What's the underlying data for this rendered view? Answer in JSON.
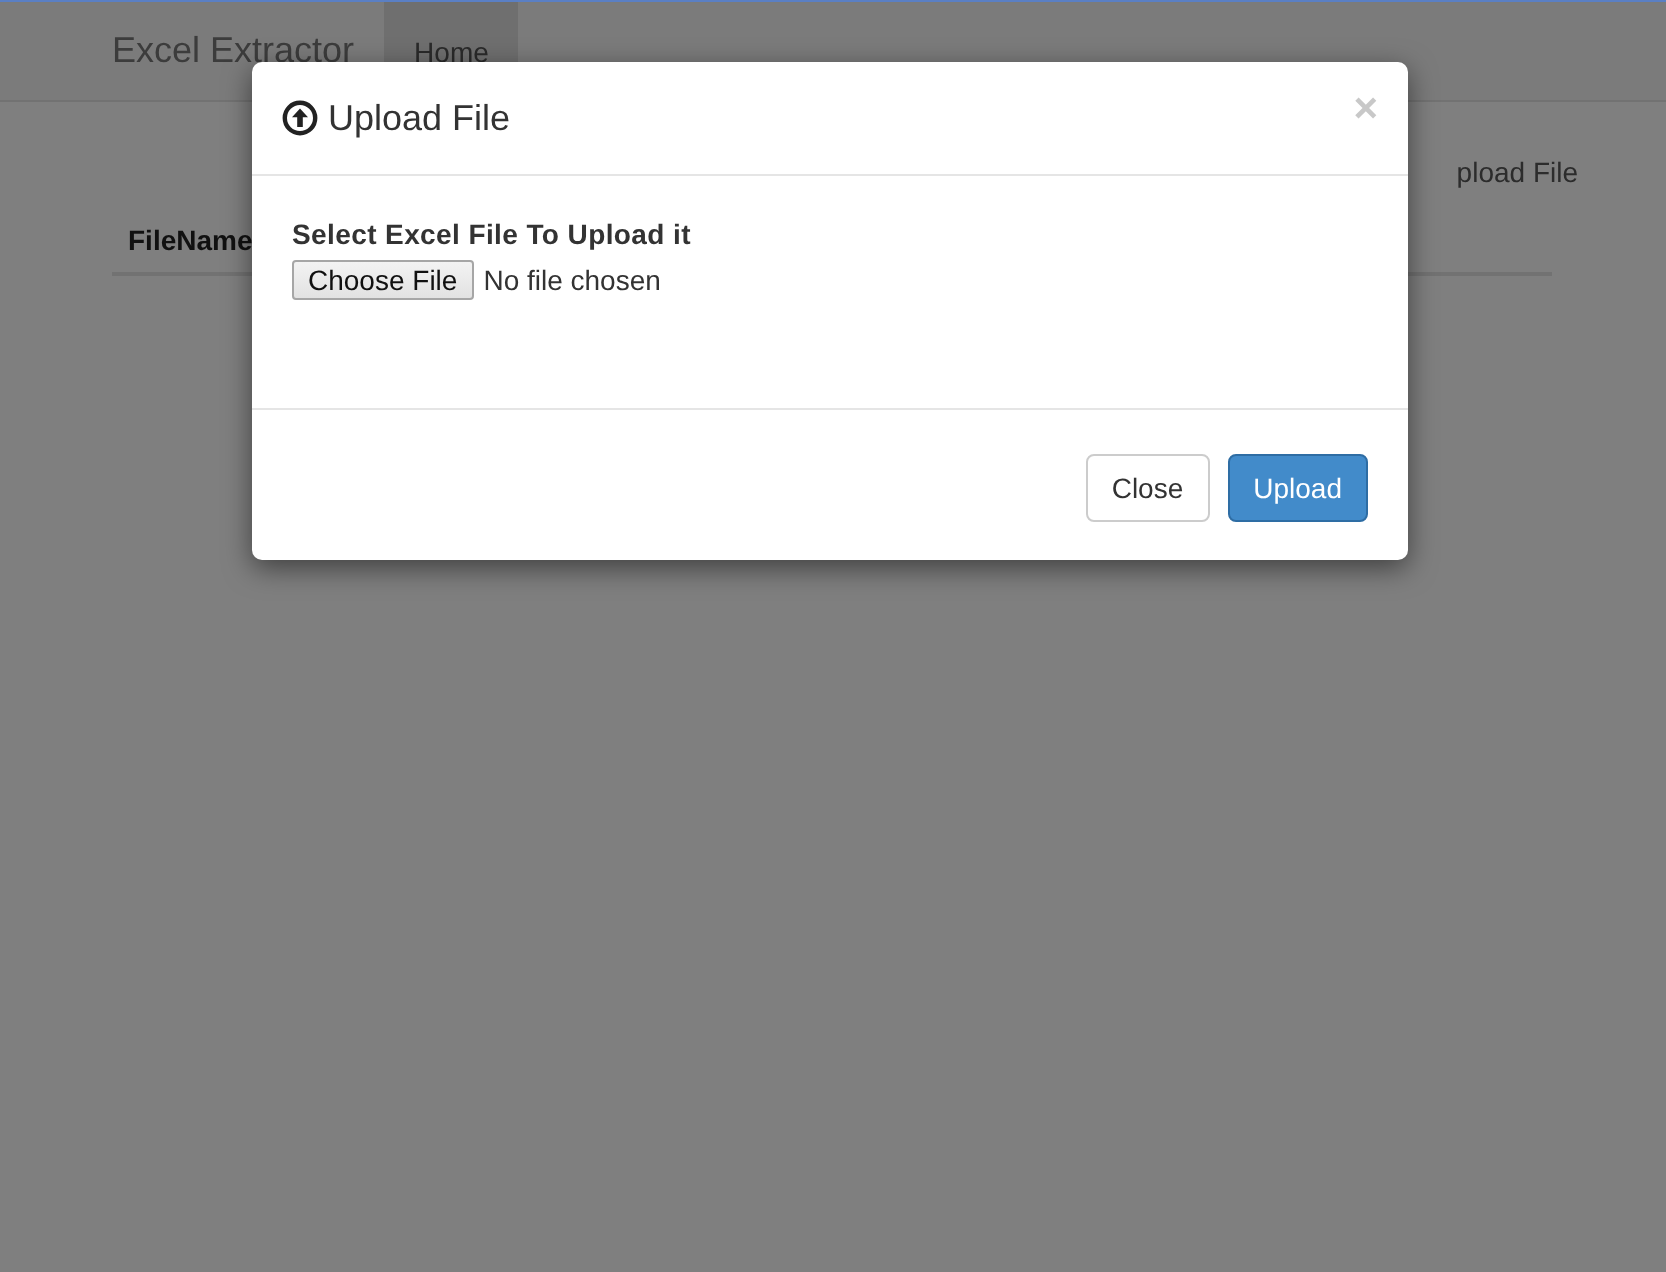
{
  "navbar": {
    "brand": "Excel Extractor",
    "items": [
      {
        "label": "Home",
        "selected": true
      }
    ]
  },
  "page": {
    "upload_link": "pload File",
    "table": {
      "columns": [
        "FileName"
      ]
    }
  },
  "modal": {
    "title": "Upload File",
    "close_symbol": "×",
    "label": "Select Excel File To Upload it",
    "file_button": "Choose File",
    "file_status": "No file chosen",
    "buttons": [
      {
        "label": "Close",
        "kind": "default"
      },
      {
        "label": "Upload",
        "kind": "primary"
      }
    ]
  }
}
